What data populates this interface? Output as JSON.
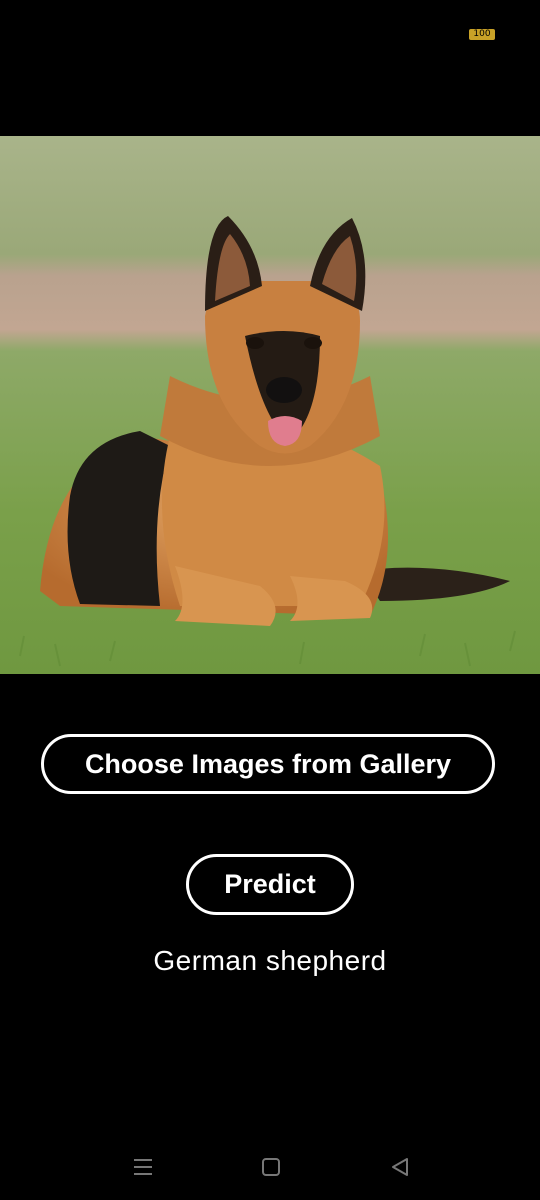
{
  "status_bar": {
    "battery_level": "100",
    "battery_color": "#c9a227"
  },
  "image": {
    "subject": "german-shepherd-photo"
  },
  "actions": {
    "choose_gallery_label": "Choose Images from Gallery",
    "predict_label": "Predict"
  },
  "result": {
    "prediction": "German shepherd"
  },
  "nav_bar": {
    "icons": [
      "menu-icon",
      "home-icon",
      "back-icon"
    ]
  }
}
